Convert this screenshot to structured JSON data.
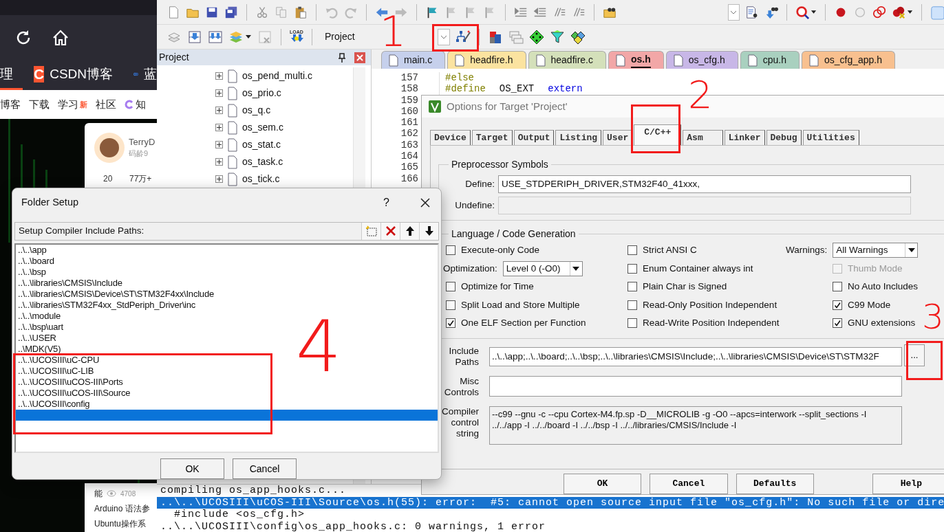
{
  "browser": {
    "bookmarks": [
      {
        "label": "理",
        "kind": "plain"
      },
      {
        "label": "CSDN博客",
        "kind": "csdn",
        "logo": "C"
      },
      {
        "label": "蓝",
        "kind": "rings"
      }
    ],
    "nav": [
      {
        "label": "博客"
      },
      {
        "label": "下载"
      },
      {
        "label": "学习",
        "badge": "新"
      },
      {
        "label": "社区"
      },
      {
        "label": "知",
        "icon": true
      }
    ],
    "profile": {
      "name": "TerryD",
      "age": "码龄9",
      "stats": [
        "20",
        "77万+"
      ]
    },
    "feed": [
      {
        "label": "能",
        "count": "4708"
      },
      {
        "label": "Arduino 语法参"
      },
      {
        "label": "Ubuntu操作系"
      }
    ]
  },
  "ide": {
    "load_label": "LOAD",
    "build_target": "Project",
    "project_panel": {
      "title": "Project",
      "files": [
        "os_pend_multi.c",
        "os_prio.c",
        "os_q.c",
        "os_sem.c",
        "os_stat.c",
        "os_task.c",
        "os_tick.c"
      ]
    },
    "tabs": [
      {
        "label": "main.c",
        "color": "#c6d0ec",
        "selected": false
      },
      {
        "label": "headfire.h",
        "color": "#fbe3a0",
        "selected": false
      },
      {
        "label": "headfire.c",
        "color": "#d4e0ba",
        "selected": false
      },
      {
        "label": "os.h",
        "color": "#f2a7a7",
        "selected": true
      },
      {
        "label": "os_cfg.h",
        "color": "#c8b7e7",
        "selected": false
      },
      {
        "label": "cpu.h",
        "color": "#a9d0bf",
        "selected": false
      },
      {
        "label": "os_cfg_app.h",
        "color": "#f8c08f",
        "selected": false
      }
    ],
    "code": [
      {
        "line": "157",
        "tokens": [
          {
            "text": "#else",
            "kind": "directive"
          }
        ]
      },
      {
        "line": "158",
        "tokens": [
          {
            "text": "#define",
            "kind": "directive"
          },
          {
            "text": "OS_EXT",
            "kind": "plain"
          },
          {
            "text": "extern",
            "kind": "keyword"
          }
        ]
      },
      {
        "line": "159"
      },
      {
        "line": "160"
      },
      {
        "line": "161"
      },
      {
        "line": "162"
      },
      {
        "line": "163"
      },
      {
        "line": "164"
      },
      {
        "line": "165"
      },
      {
        "line": "166"
      }
    ],
    "output": [
      {
        "text": "compiling os_app_hooks.c...",
        "selected": false
      },
      {
        "text": "..\\..\\UCOSIII\\uCOS-III\\Source\\os.h(55): error:  #5: cannot open source input file \"os_cfg.h\": No such file or dire",
        "selected": true
      },
      {
        "text": "  #include <os_cfg.h>",
        "selected": false
      },
      {
        "text": "..\\..\\UCOSIII\\config\\os_app_hooks.c: 0 warnings, 1 error",
        "selected": false
      }
    ]
  },
  "options_dialog": {
    "title": "Options for Target 'Project'",
    "tabs": [
      {
        "label": "Device",
        "selected": false
      },
      {
        "label": "Target",
        "selected": false
      },
      {
        "label": "Output",
        "selected": false
      },
      {
        "label": "Listing",
        "selected": false
      },
      {
        "label": "User",
        "selected": false
      },
      {
        "label": "C/C++",
        "selected": true
      },
      {
        "label": "Asm",
        "selected": false
      },
      {
        "label": "Linker",
        "selected": false
      },
      {
        "label": "Debug",
        "selected": false
      },
      {
        "label": "Utilities",
        "selected": false
      }
    ],
    "preprocessor": {
      "title": "Preprocessor Symbols",
      "fields": [
        {
          "label": "Define:",
          "value": "USE_STDPERIPH_DRIVER,STM32F40_41xxx,",
          "disabled": false
        },
        {
          "label": "Undefine:",
          "disabled": true
        }
      ]
    },
    "language": {
      "title": "Language / Code Generation",
      "columns": [
        [
          {
            "kind": "checkbox",
            "label": "Execute-only Code",
            "checked": false,
            "disabled": false
          },
          {
            "kind": "select",
            "label": "Optimization:",
            "value": "Level 0 (-O0)"
          },
          {
            "kind": "checkbox",
            "label": "Optimize for Time",
            "checked": false,
            "disabled": false
          },
          {
            "kind": "checkbox",
            "label": "Split Load and Store Multiple",
            "checked": false,
            "disabled": false
          },
          {
            "kind": "checkbox",
            "label": "One ELF Section per Function",
            "checked": true,
            "disabled": false
          }
        ],
        [
          {
            "kind": "checkbox",
            "label": "Strict ANSI C",
            "checked": false,
            "disabled": false
          },
          {
            "kind": "checkbox",
            "label": "Enum Container always int",
            "checked": false,
            "disabled": false
          },
          {
            "kind": "checkbox",
            "label": "Plain Char is Signed",
            "checked": false,
            "disabled": false
          },
          {
            "kind": "checkbox",
            "label": "Read-Only Position Independent",
            "checked": false,
            "disabled": false
          },
          {
            "kind": "checkbox",
            "label": "Read-Write Position Independent",
            "checked": false,
            "disabled": false
          }
        ],
        [
          {
            "kind": "select",
            "label": "Warnings:",
            "value": "All Warnings"
          },
          {
            "kind": "checkbox",
            "label": "Thumb Mode",
            "checked": false,
            "disabled": true
          },
          {
            "kind": "checkbox",
            "label": "No Auto Includes",
            "checked": false,
            "disabled": false
          },
          {
            "kind": "checkbox",
            "label": "C99 Mode",
            "checked": true,
            "disabled": false
          },
          {
            "kind": "checkbox",
            "label": "GNU extensions",
            "checked": true,
            "disabled": false
          }
        ]
      ]
    },
    "paths": [
      {
        "kind": "path",
        "label": "Include Paths",
        "value": "..\\..\\app;..\\..\\board;..\\..\\bsp;..\\..\\libraries\\CMSIS\\Include;..\\..\\libraries\\CMSIS\\Device\\ST\\STM32F",
        "button": "..."
      },
      {
        "kind": "text",
        "label": "Misc Controls"
      },
      {
        "kind": "readonly",
        "label": "Compiler control string",
        "lines": [
          "--c99 --gnu -c --cpu Cortex-M4.fp.sp -D__MICROLIB -g -O0 --apcs=interwork --split_sections -I",
          "../../app -I ../../board -I ../../bsp -I ../../libraries/CMSIS/Include -I"
        ]
      }
    ],
    "buttons": [
      "OK",
      "Cancel",
      "Defaults",
      "Help"
    ]
  },
  "folder_dialog": {
    "title": "Folder Setup",
    "help": "?",
    "label": "Setup Compiler Include Paths:",
    "paths": [
      {
        "text": "..\\..\\app",
        "selected": false
      },
      {
        "text": "..\\..\\board",
        "selected": false
      },
      {
        "text": "..\\..\\bsp",
        "selected": false
      },
      {
        "text": "..\\..\\libraries\\CMSIS\\Include",
        "selected": false
      },
      {
        "text": "..\\..\\libraries\\CMSIS\\Device\\ST\\STM32F4xx\\Include",
        "selected": false
      },
      {
        "text": "..\\..\\libraries\\STM32F4xx_StdPeriph_Driver\\inc",
        "selected": false
      },
      {
        "text": "..\\..\\module",
        "selected": false
      },
      {
        "text": "..\\..\\bsp\\uart",
        "selected": false
      },
      {
        "text": "..\\..\\USER",
        "selected": false
      },
      {
        "text": "..\\MDK(V5)",
        "selected": false
      },
      {
        "text": "..\\..\\UCOSIII\\uC-CPU",
        "selected": false
      },
      {
        "text": "..\\..\\UCOSIII\\uC-LIB",
        "selected": false
      },
      {
        "text": "..\\..\\UCOSIII\\uCOS-III\\Ports",
        "selected": false
      },
      {
        "text": "..\\..\\UCOSIII\\uCOS-III\\Source",
        "selected": false
      },
      {
        "text": "..\\..\\UCOSIII\\config",
        "selected": false
      }
    ],
    "blank_row": {
      "selected": true
    },
    "buttons": [
      "OK",
      "Cancel"
    ]
  },
  "annotations": [
    {
      "kind": "box"
    },
    {
      "kind": "box"
    },
    {
      "kind": "box"
    },
    {
      "kind": "box"
    },
    {
      "kind": "number",
      "label": "1"
    },
    {
      "kind": "number",
      "label": "2"
    },
    {
      "kind": "number",
      "label": "3"
    },
    {
      "kind": "number",
      "label": "4"
    }
  ]
}
